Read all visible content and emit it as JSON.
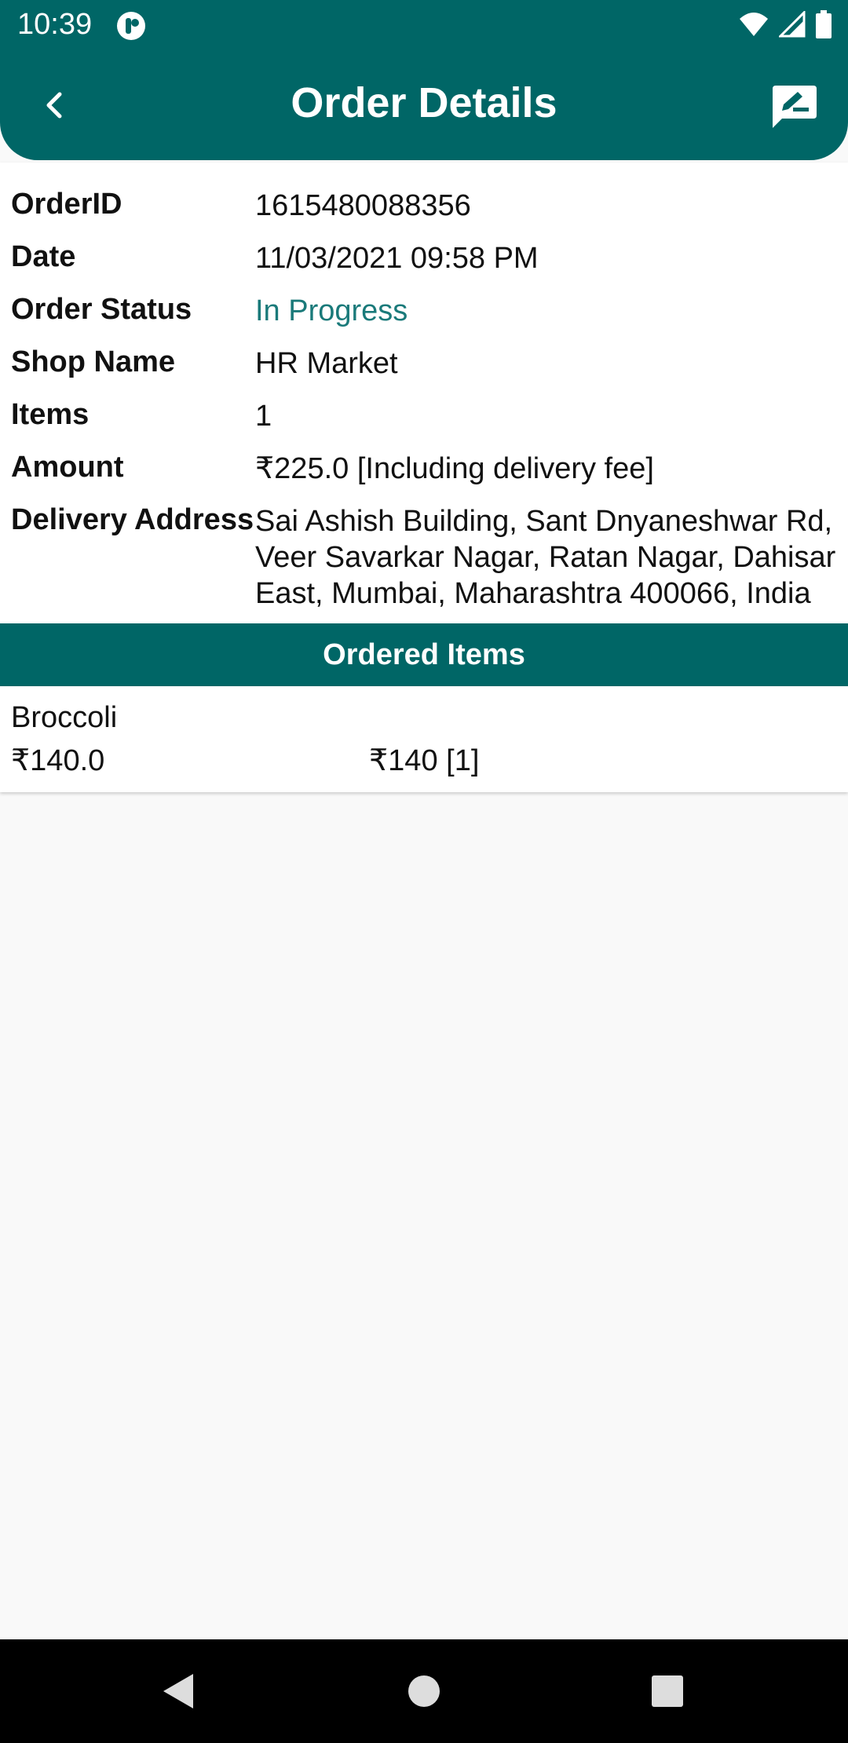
{
  "status_bar": {
    "time": "10:39"
  },
  "toolbar": {
    "title": "Order Details",
    "back_icon": "chevron-left-icon",
    "feedback_icon": "feedback-icon"
  },
  "details": {
    "order_id_label": "OrderID",
    "order_id_value": "1615480088356",
    "date_label": "Date",
    "date_value": "11/03/2021 09:58 PM",
    "status_label": "Order Status",
    "status_value": "In Progress",
    "shop_label": "Shop Name",
    "shop_value": "HR Market",
    "items_label": "Items",
    "items_value": "1",
    "amount_label": "Amount",
    "amount_value": "₹225.0 [Including delivery fee]",
    "address_label": "Delivery Address",
    "address_value": "Sai Ashish Building, Sant Dnyaneshwar Rd, Veer Savarkar Nagar, Ratan Nagar, Dahisar East, Mumbai, Maharashtra 400066, India"
  },
  "ordered_items": {
    "header": "Ordered Items",
    "items": [
      {
        "name": "Broccoli",
        "price": "₹140.0",
        "qty": "₹140 [1]"
      }
    ]
  },
  "colors": {
    "primary": "#006666",
    "status_text": "#1a7a7a"
  }
}
